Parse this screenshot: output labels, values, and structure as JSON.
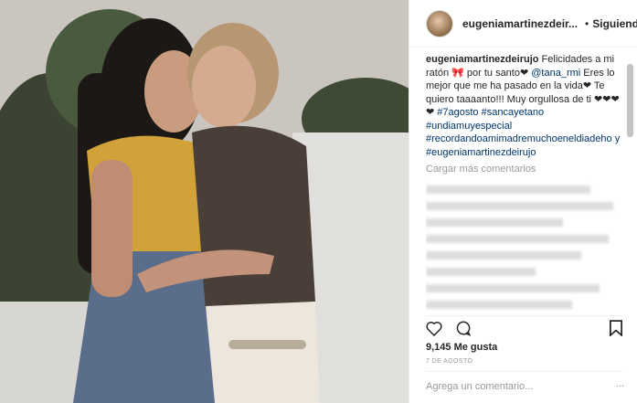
{
  "header": {
    "username": "eugeniamartinezdeir...",
    "follow_label": "Siguiendo",
    "dot": "•"
  },
  "caption": {
    "username": "eugeniamartinezdeirujo",
    "text_1": "Felicidades a mi ratón 🎀 por tu santo❤ ",
    "mention": "@tana_rmi",
    "text_2": " Eres lo mejor que me ha pasado en la vida❤ Te quiero taaaanto!!! Muy orgullosa de ti ❤❤❤❤ ",
    "hashtags": [
      "#7agosto",
      "#sancayetano",
      "#undiamuyespecial",
      "#recordandoamimadremuchoeneldiadeho y",
      "#eugeniamartinezdeirujo"
    ]
  },
  "load_more_label": "Cargar más comentarios",
  "likes_label": "9,145 Me gusta",
  "date_label": "7 DE AGOSTO",
  "add_comment_placeholder": "Agrega un comentario...",
  "more_label": "...",
  "icons": [
    "heart-icon",
    "comment-icon",
    "bookmark-icon",
    "verified-badge-icon",
    "avatar"
  ],
  "colors": {
    "link": "#003569",
    "muted": "#999999",
    "verified": "#3897f0"
  }
}
